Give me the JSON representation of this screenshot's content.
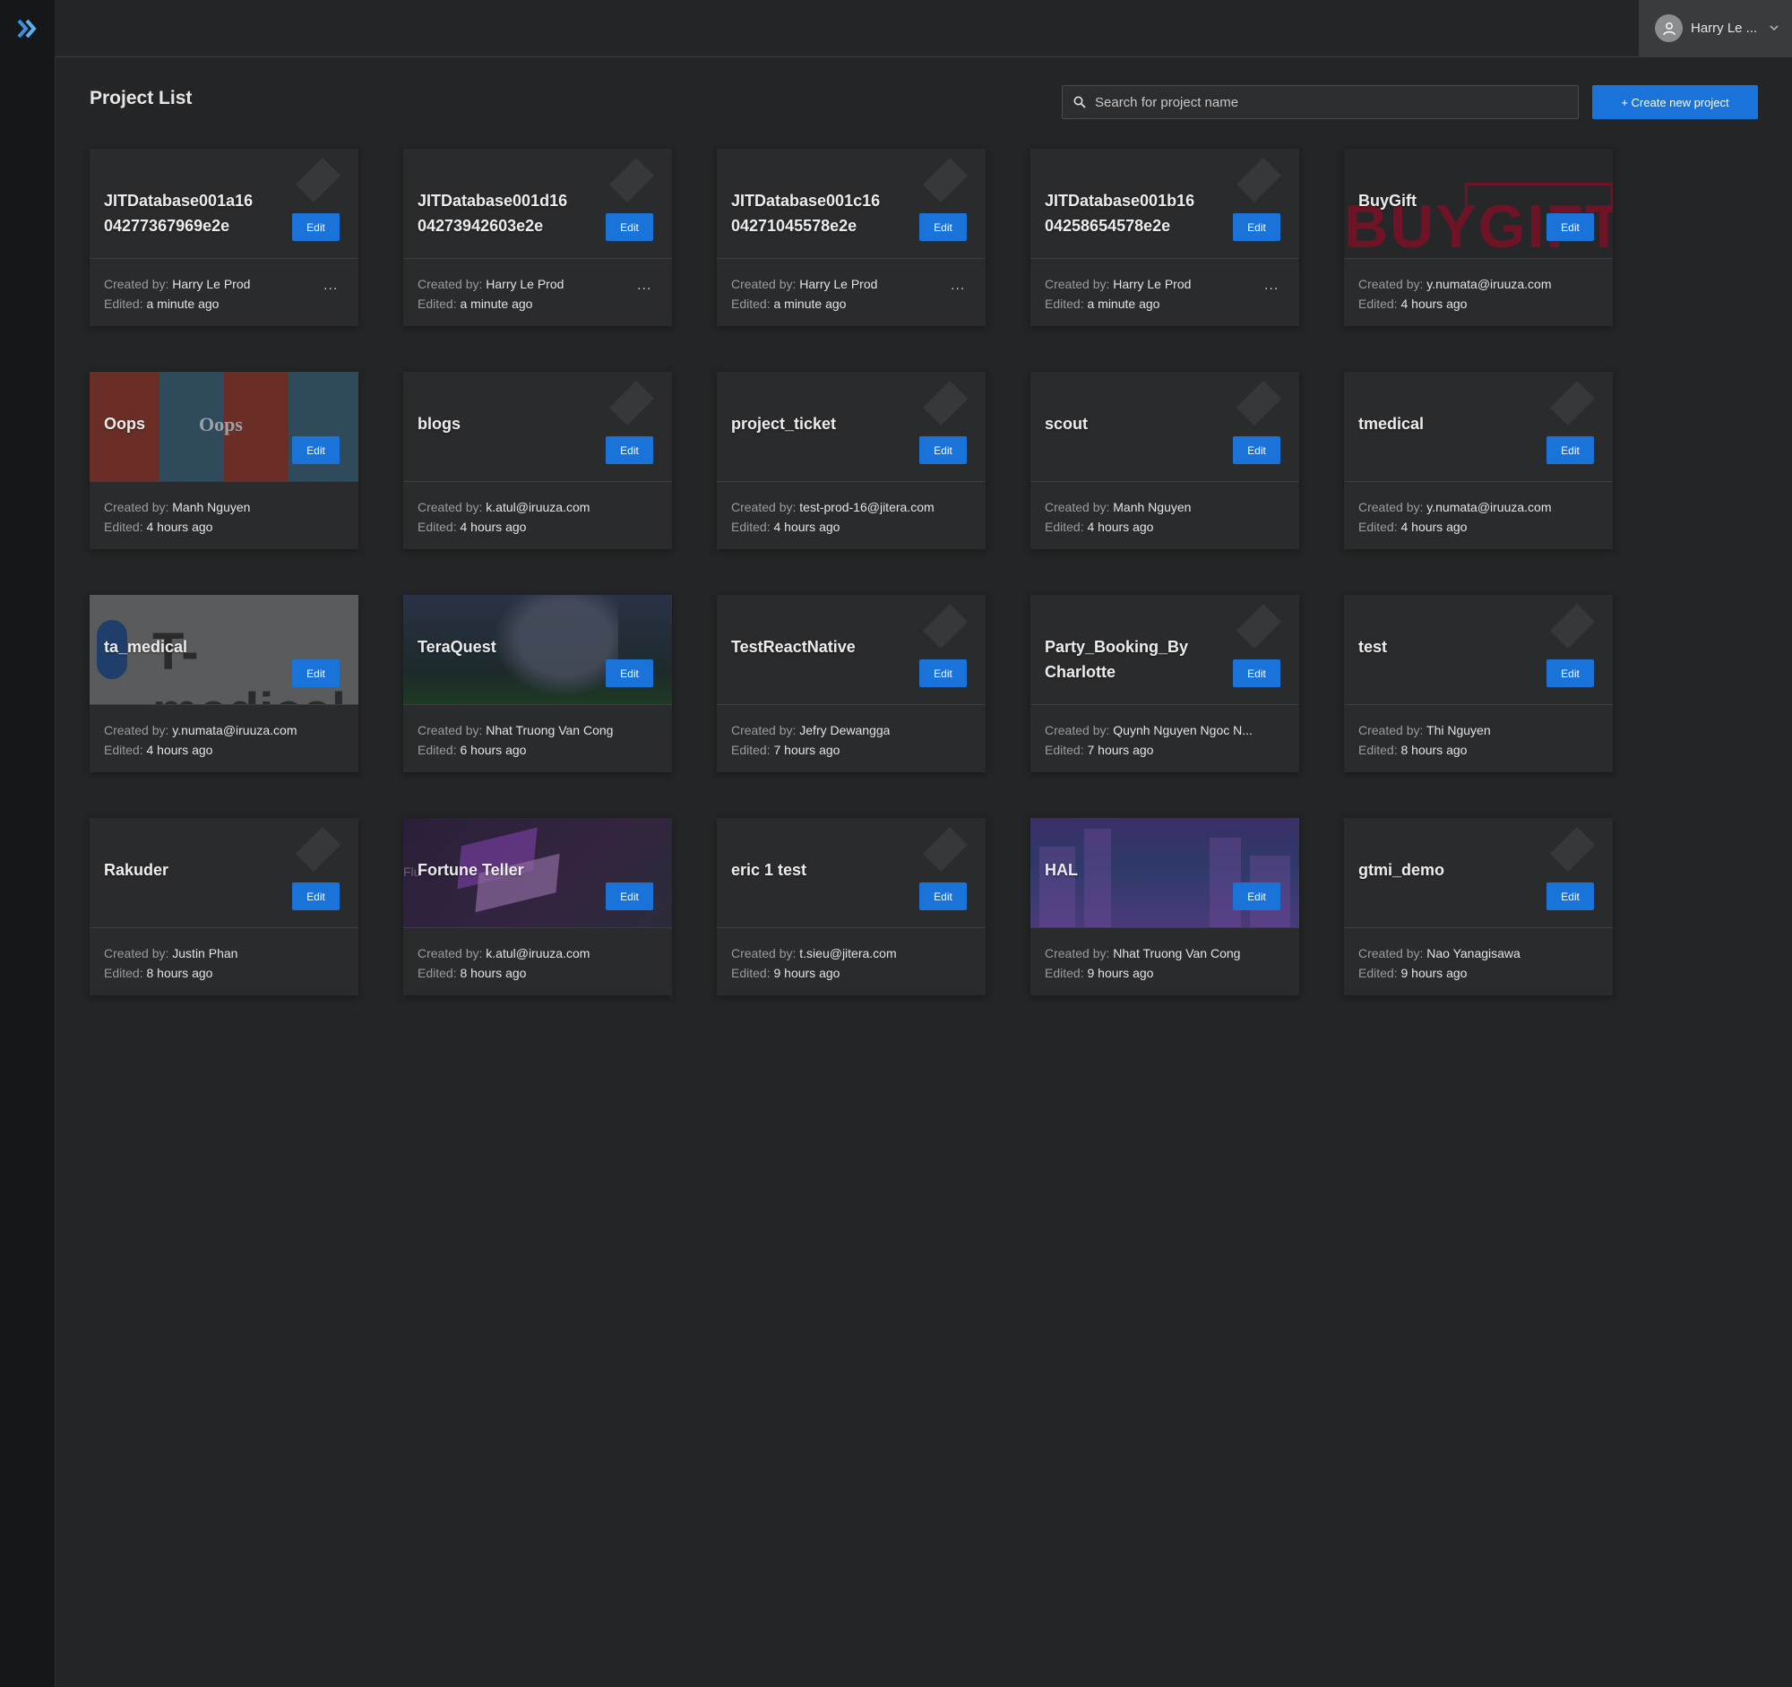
{
  "header": {
    "user_name": "Harry Le ..."
  },
  "page": {
    "title": "Project List",
    "search_placeholder": "Search for project name",
    "create_label": "+ Create new project"
  },
  "labels": {
    "created_by": "Created by:",
    "edited": "Edited:",
    "edit": "Edit",
    "more": "..."
  },
  "projects": [
    {
      "name": "JITDatabase001a16 04277367969e2e",
      "created_by": "Harry Le Prod",
      "edited": "a minute ago"
    },
    {
      "name": "JITDatabase001d16 04273942603e2e",
      "created_by": "Harry Le Prod",
      "edited": "a minute ago"
    },
    {
      "name": "JITDatabase001c16 04271045578e2e",
      "created_by": "Harry Le Prod",
      "edited": "a minute ago"
    },
    {
      "name": "JITDatabase001b16 04258654578e2e",
      "created_by": "Harry Le Prod",
      "edited": "a minute ago"
    },
    {
      "name": "BuyGift",
      "created_by": "y.numata@iruuza.com",
      "edited": "4 hours ago",
      "thumb_text": "BUYGIFT"
    },
    {
      "name": "Oops",
      "created_by": "Manh Nguyen",
      "edited": "4 hours ago",
      "thumb_text": "Oops"
    },
    {
      "name": "blogs",
      "created_by": "k.atul@iruuza.com",
      "edited": "4 hours ago"
    },
    {
      "name": "project_ticket",
      "created_by": "test-prod-16@jitera.com",
      "edited": "4 hours ago"
    },
    {
      "name": "scout",
      "created_by": "Manh Nguyen",
      "edited": "4 hours ago"
    },
    {
      "name": "tmedical",
      "created_by": "y.numata@iruuza.com",
      "edited": "4 hours ago"
    },
    {
      "name": "ta_medical",
      "created_by": "y.numata@iruuza.com",
      "edited": "4 hours ago",
      "thumb_text": "T-medical"
    },
    {
      "name": "TeraQuest",
      "created_by": "Nhat Truong Van Cong",
      "edited": "6 hours ago"
    },
    {
      "name": "TestReactNative",
      "created_by": "Jefry Dewangga",
      "edited": "7 hours ago"
    },
    {
      "name": "Party_Booking_By Charlotte",
      "created_by": "Quynh Nguyen Ngoc N...",
      "edited": "7 hours ago"
    },
    {
      "name": "test",
      "created_by": "Thi Nguyen",
      "edited": "8 hours ago"
    },
    {
      "name": "Rakuder",
      "created_by": "Justin Phan",
      "edited": "8 hours ago"
    },
    {
      "name": "Fortune Teller",
      "created_by": "k.atul@iruuza.com",
      "edited": "8 hours ago",
      "thumb_text": "Flu"
    },
    {
      "name": "eric 1 test",
      "created_by": "t.sieu@jitera.com",
      "edited": "9 hours ago"
    },
    {
      "name": "HAL",
      "created_by": "Nhat Truong Van Cong",
      "edited": "9 hours ago"
    },
    {
      "name": "gtmi_demo",
      "created_by": "Nao Yanagisawa",
      "edited": "9 hours ago"
    }
  ],
  "colors": {
    "accent": "#1a73d9",
    "background": "#242526",
    "card": "#2a2b2d",
    "sidebar": "#161718"
  },
  "icons": {
    "logo": "double-chevron-right-icon",
    "search": "search-icon",
    "avatar": "user-icon",
    "dropdown": "chevron-down-icon"
  }
}
